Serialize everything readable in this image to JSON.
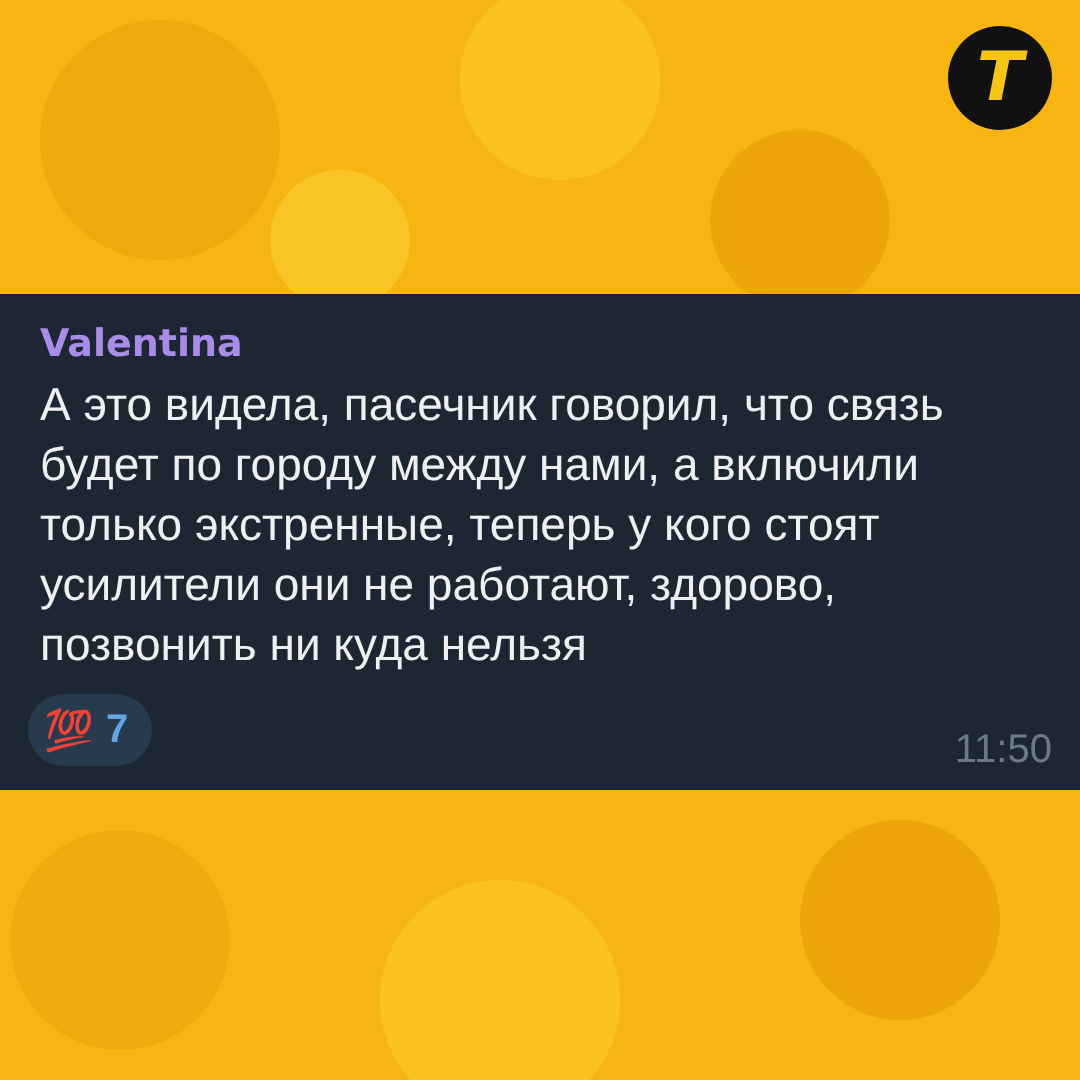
{
  "logo": {
    "text": "T"
  },
  "message": {
    "sender": "Valentina",
    "text": "А это видела, пасечник говорил, что связь будет по городу между нами, а включили только экстренные, теперь у кого стоят усилители они не работают, здорово, позвонить ни куда нельзя",
    "reactions": [
      {
        "emoji": "💯",
        "count": "7"
      }
    ],
    "time": "11:50"
  }
}
